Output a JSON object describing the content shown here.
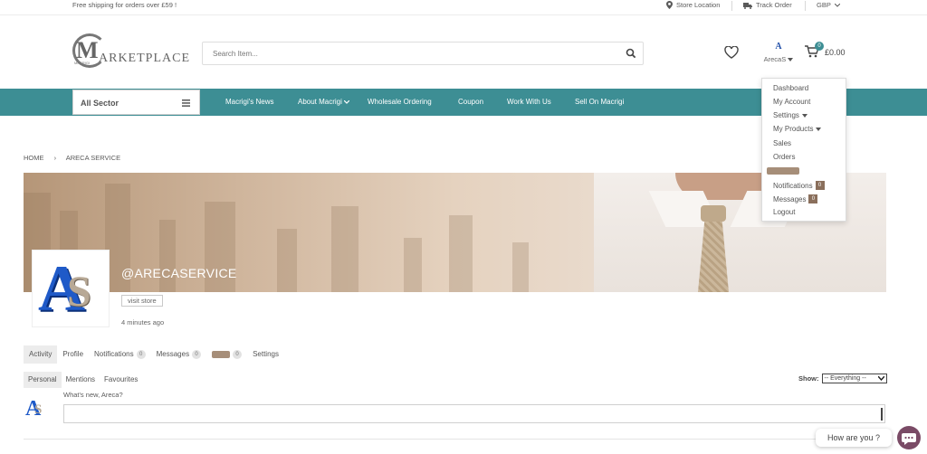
{
  "topbar": {
    "promo": "Free shipping for orders over £59 !",
    "store_location": "Store Location",
    "track_order": "Track Order",
    "currency": "GBP"
  },
  "header": {
    "logo_tiny": "MACRIGI",
    "logo_letter": "M",
    "logo_word": "ARKETPLACE",
    "search_placeholder": "Search Item...",
    "user_mini_avatar": "A",
    "user_name": "ArecaS",
    "cart_count": "0",
    "cart_total": "£0.00"
  },
  "nav": {
    "sector_label": "All Sector",
    "items": [
      "Macrigi's News",
      "About Macrigi",
      "Wholesale Ordering",
      "Coupon",
      "Work With Us",
      "Sell On Macrigi"
    ]
  },
  "breadcrumb": {
    "home": "HOME",
    "separator": "›",
    "current": "ARECA SERVICE"
  },
  "profile": {
    "avatar_letter": "A",
    "avatar_letter_2": "S",
    "handle": "@ARECASERVICE",
    "visit_store": "visit store",
    "last_active": "4 minutes ago"
  },
  "tabs": {
    "items": [
      {
        "label": "Activity",
        "count": ""
      },
      {
        "label": "Profile",
        "count": ""
      },
      {
        "label": "Notifications",
        "count": "0"
      },
      {
        "label": "Messages",
        "count": "0"
      },
      {
        "label": "",
        "count": "0"
      },
      {
        "label": "Settings",
        "count": ""
      }
    ]
  },
  "subtabs": {
    "items": [
      "Personal",
      "Mentions",
      "Favourites"
    ]
  },
  "filter": {
    "label": "Show:",
    "selected": "-- Everything --"
  },
  "activity_post": {
    "prompt": "What's new, Areca?"
  },
  "user_menu": {
    "items": [
      {
        "label": "Dashboard",
        "count": ""
      },
      {
        "label": "My Account",
        "count": ""
      },
      {
        "label": "Settings",
        "count": ""
      },
      {
        "label": "My Products",
        "count": ""
      },
      {
        "label": "Sales",
        "count": ""
      },
      {
        "label": "Orders",
        "count": ""
      },
      {
        "label": "",
        "count": ""
      },
      {
        "label": "Notifications",
        "count": "0"
      },
      {
        "label": "Messages",
        "count": "0"
      },
      {
        "label": "Logout",
        "count": ""
      }
    ]
  },
  "chat": {
    "bubble": "How are you ?"
  },
  "colors": {
    "teal": "#3d8e94",
    "brown_badge": "#8a6f5c",
    "chat": "#7a4b66"
  }
}
